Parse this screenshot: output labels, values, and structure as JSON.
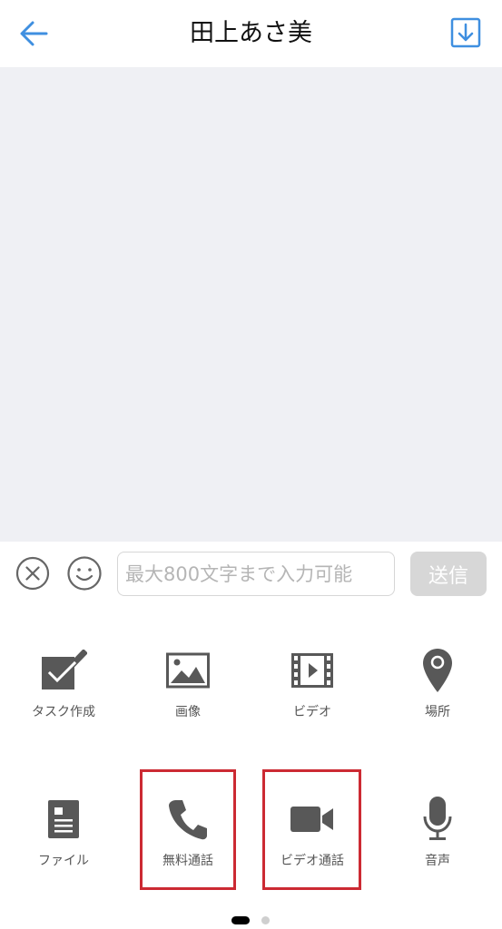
{
  "header": {
    "title": "田上あさ美",
    "back_icon": "arrow-left-icon",
    "download_icon": "download-icon",
    "accent_color": "#3f8fe0"
  },
  "input_bar": {
    "placeholder": "最大800文字まで入力可能",
    "send_label": "送信",
    "clear_icon": "close-circle-icon",
    "emoji_icon": "smiley-icon"
  },
  "attachments": {
    "row1": [
      {
        "label": "タスク作成",
        "icon": "task-check-icon"
      },
      {
        "label": "画像",
        "icon": "image-icon"
      },
      {
        "label": "ビデオ",
        "icon": "film-icon"
      },
      {
        "label": "場所",
        "icon": "location-pin-icon"
      }
    ],
    "row2": [
      {
        "label": "ファイル",
        "icon": "file-icon"
      },
      {
        "label": "無料通話",
        "icon": "phone-icon"
      },
      {
        "label": "ビデオ通話",
        "icon": "video-camera-icon"
      },
      {
        "label": "音声",
        "icon": "microphone-icon"
      }
    ],
    "highlight_color": "#cc2a33"
  },
  "pager": {
    "pages": 2,
    "current": 1
  }
}
